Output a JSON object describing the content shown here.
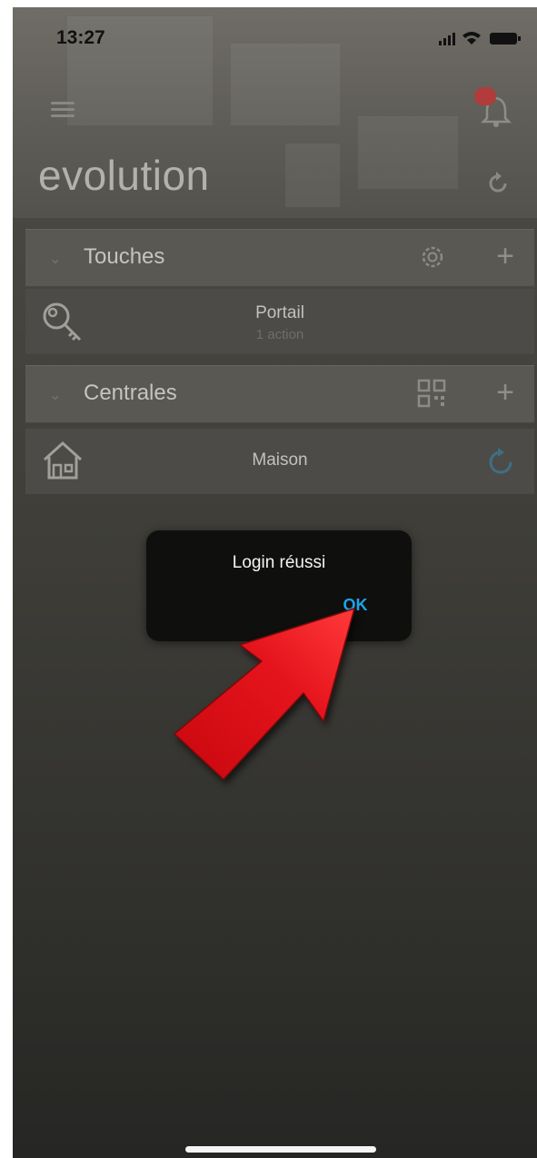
{
  "status_bar": {
    "time": "13:27"
  },
  "header": {
    "title": "evolution",
    "notification_badge": ""
  },
  "sections": [
    {
      "label": "Touches",
      "items": [
        {
          "label": "Portail",
          "sublabel": "1 action"
        }
      ]
    },
    {
      "label": "Centrales",
      "items": [
        {
          "label": "Maison"
        }
      ]
    }
  ],
  "dialog": {
    "message": "Login réussi",
    "ok_label": "OK"
  },
  "colors": {
    "accent": "#1ea3ea",
    "annotation_arrow": "#e3141b"
  },
  "icons": [
    "menu-icon",
    "bell-icon",
    "refresh-icon",
    "chevron-down-icon",
    "gear-icon",
    "plus-icon",
    "key-icon",
    "qr-code-icon",
    "house-icon",
    "sync-icon"
  ]
}
